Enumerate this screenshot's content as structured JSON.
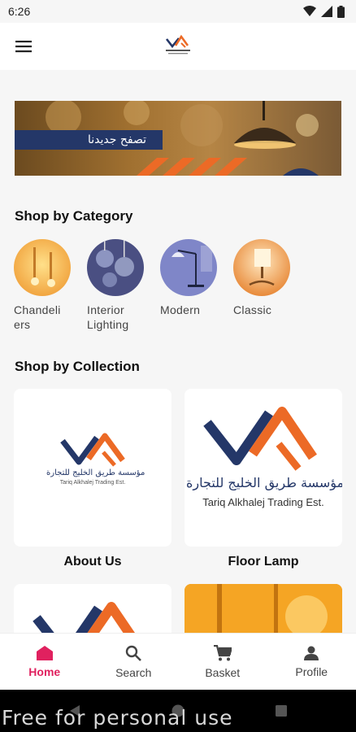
{
  "status_bar": {
    "time": "6:26"
  },
  "banner": {
    "text": "تصفح جديدنا"
  },
  "sections": {
    "category_title": "Shop by Category",
    "collection_title": "Shop by Collection"
  },
  "categories": [
    {
      "label": "Chandeli\ners"
    },
    {
      "label": "Interior\nLighting"
    },
    {
      "label": "Modern"
    },
    {
      "label": "Classic"
    }
  ],
  "collections": [
    {
      "label": "About Us",
      "logo_ar": "مؤسسة طريق الخليج للتجارة",
      "logo_en": "Tariq Alkhalej Trading Est."
    },
    {
      "label": "Floor Lamp",
      "logo_ar": "مؤسسة طريق الخليج للتجارة",
      "logo_en": "Tariq Alkhalej Trading Est."
    }
  ],
  "bottom_nav": [
    {
      "label": "Home",
      "icon": "home-icon",
      "active": true
    },
    {
      "label": "Search",
      "icon": "search-icon"
    },
    {
      "label": "Basket",
      "icon": "cart-icon"
    },
    {
      "label": "Profile",
      "icon": "profile-icon"
    }
  ],
  "watermark": "Free for personal use",
  "colors": {
    "accent": "#e0215f",
    "brand_blue": "#243768",
    "brand_orange": "#ec6a26"
  }
}
